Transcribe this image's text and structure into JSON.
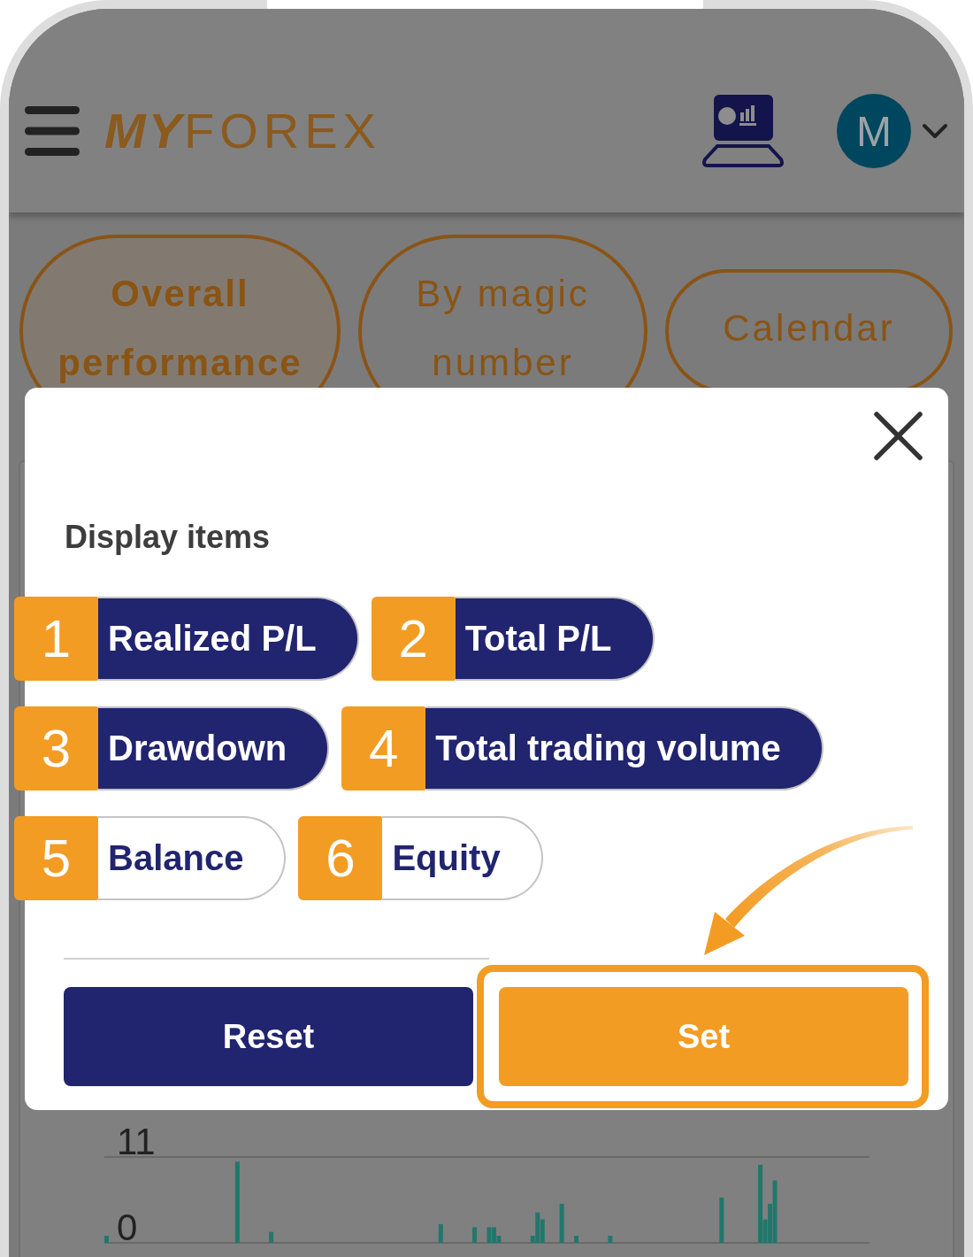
{
  "header": {
    "logo": "**MY**FOREX",
    "avatar": {
      "initial": "M"
    }
  },
  "tabs": [
    {
      "label": "Overall performance",
      "selected": true
    },
    {
      "label": "By magic number",
      "selected": false
    },
    {
      "label": "Calendar",
      "selected": false
    }
  ],
  "dialog": {
    "title": "Display items",
    "items": [
      {
        "marker": "1",
        "label": "Realized P/L",
        "selected": true
      },
      {
        "marker": "2",
        "label": "Total P/L",
        "selected": true
      },
      {
        "marker": "3",
        "label": "Drawdown",
        "selected": true
      },
      {
        "marker": "4",
        "label": "Total trading volume",
        "selected": true
      },
      {
        "marker": "5",
        "label": "Balance",
        "selected": false
      },
      {
        "marker": "6",
        "label": "Equity",
        "selected": false
      }
    ],
    "buttons": [
      {
        "label": "Reset",
        "kind": "secondary",
        "highlighted": false
      },
      {
        "label": "Set",
        "kind": "primary",
        "highlighted": true
      }
    ]
  },
  "chart": {
    "chart_data": {
      "type": "bar",
      "categories": [
        null,
        null,
        null,
        null,
        null,
        null,
        null,
        null,
        null,
        null,
        null,
        null,
        null,
        null,
        null,
        null,
        null,
        null,
        null,
        null,
        null,
        null,
        null,
        null,
        null,
        null,
        null,
        null,
        null,
        null,
        null,
        null,
        null,
        null,
        null,
        null,
        null,
        null,
        null,
        null,
        null,
        null,
        null,
        null,
        null,
        null,
        null,
        null,
        null,
        null,
        null,
        null,
        null,
        null,
        null,
        null,
        null,
        null,
        null,
        null,
        null,
        null,
        null,
        null,
        null,
        null,
        null,
        null,
        null,
        null,
        null,
        null,
        null,
        null,
        null,
        null,
        null,
        null,
        null,
        null,
        null,
        null,
        null,
        null,
        null,
        null,
        null,
        null,
        null,
        null,
        null,
        null,
        null,
        null,
        null,
        null,
        null,
        null,
        null,
        null,
        null,
        null,
        null,
        null,
        null,
        null,
        null,
        null,
        null,
        null,
        null,
        null,
        null,
        null,
        null,
        null,
        null,
        null,
        null,
        null,
        null,
        null,
        null,
        null,
        null,
        null,
        null,
        null,
        null,
        null,
        null,
        null,
        null,
        null,
        null,
        null,
        null,
        null,
        null,
        null,
        null,
        null,
        null,
        null,
        null,
        null,
        null,
        null,
        null,
        null,
        null,
        null,
        null,
        null,
        null,
        null,
        null,
        null
      ],
      "values": [
        0.9,
        null,
        null,
        null,
        null,
        null,
        null,
        null,
        null,
        null,
        null,
        null,
        null,
        null,
        null,
        null,
        null,
        null,
        null,
        null,
        null,
        null,
        null,
        null,
        null,
        null,
        null,
        10.4,
        null,
        null,
        null,
        null,
        null,
        null,
        1.4,
        null,
        null,
        null,
        null,
        null,
        null,
        null,
        null,
        null,
        null,
        null,
        null,
        null,
        null,
        null,
        null,
        null,
        null,
        null,
        null,
        null,
        null,
        null,
        null,
        null,
        null,
        null,
        null,
        null,
        null,
        null,
        null,
        null,
        null,
        2.4,
        null,
        null,
        null,
        null,
        null,
        null,
        2,
        null,
        null,
        2,
        2,
        0.9,
        null,
        null,
        null,
        null,
        null,
        null,
        0.9,
        3.9,
        3,
        null,
        null,
        null,
        5,
        null,
        null,
        0.9,
        null,
        null,
        null,
        null,
        null,
        null,
        0.9,
        null,
        null,
        null,
        null,
        null,
        null,
        null,
        null,
        null,
        null,
        null,
        null,
        null,
        null,
        null,
        null,
        null,
        null,
        null,
        null,
        null,
        null,
        5.8,
        null,
        null,
        null,
        null,
        null,
        null,
        null,
        10,
        3,
        5,
        8,
        null,
        null,
        null,
        null,
        null,
        null,
        null,
        null,
        null,
        null,
        null,
        null,
        null,
        null,
        null,
        null,
        null,
        null,
        null
      ],
      "ylim": [
        0,
        11
      ],
      "yticks": [
        0,
        11
      ]
    }
  }
}
